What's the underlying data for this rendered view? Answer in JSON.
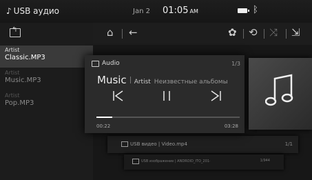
{
  "status": {
    "title": "USB аудио",
    "date": "Jan 2",
    "time": "01:05",
    "ampm": "AM"
  },
  "sidebar": {
    "items": [
      {
        "artist": "Artist",
        "name": "Classic.MP3",
        "selected": true
      },
      {
        "artist": "Artist",
        "name": "Music.MP3",
        "selected": false
      },
      {
        "artist": "Artist",
        "name": "Pop.MP3",
        "selected": false
      }
    ]
  },
  "toolbar": {
    "icons": [
      "home-icon",
      "back-arrow-icon",
      "settings-icon",
      "repeat-icon",
      "shuffle-icon",
      "source-icon"
    ]
  },
  "player": {
    "source": "Audio",
    "index": "1/3",
    "title": "Music",
    "artist": "Artist",
    "album": "Неизвестные альбомы",
    "progress": 0.11,
    "current_time": "00:22",
    "total_time": "03:28"
  },
  "cards": {
    "video_title": "USB видео | Video.mp4",
    "video_index": "1/1",
    "image_title": "USB изображение | ANDROID_ITO_201·",
    "image_index": "1/944"
  }
}
